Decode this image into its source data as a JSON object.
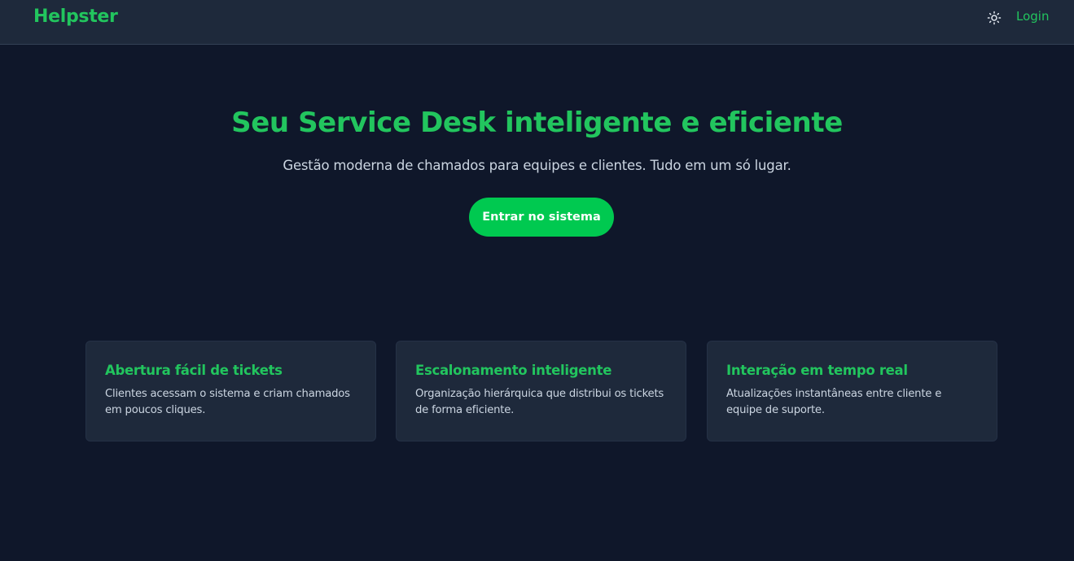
{
  "navbar": {
    "brand": "Helpster",
    "theme_icon": "sun-icon",
    "login_label": "Login"
  },
  "hero": {
    "title": "Seu Service Desk inteligente e eficiente",
    "subtitle": "Gestão moderna de chamados para equipes e clientes. Tudo em um só lugar.",
    "cta_label": "Entrar no sistema"
  },
  "features": [
    {
      "title": "Abertura fácil de tickets",
      "description": "Clientes acessam o sistema e criam chamados em poucos cliques."
    },
    {
      "title": "Escalonamento inteligente",
      "description": "Organização hierárquica que distribui os tickets de forma eficiente."
    },
    {
      "title": "Interação em tempo real",
      "description": "Atualizações instantâneas entre cliente e equipe de suporte."
    }
  ],
  "colors": {
    "background": "#0f172a",
    "surface": "#1e293b",
    "accent": "#22c55e",
    "button": "#00c950",
    "text_muted": "#cbd5e1"
  }
}
